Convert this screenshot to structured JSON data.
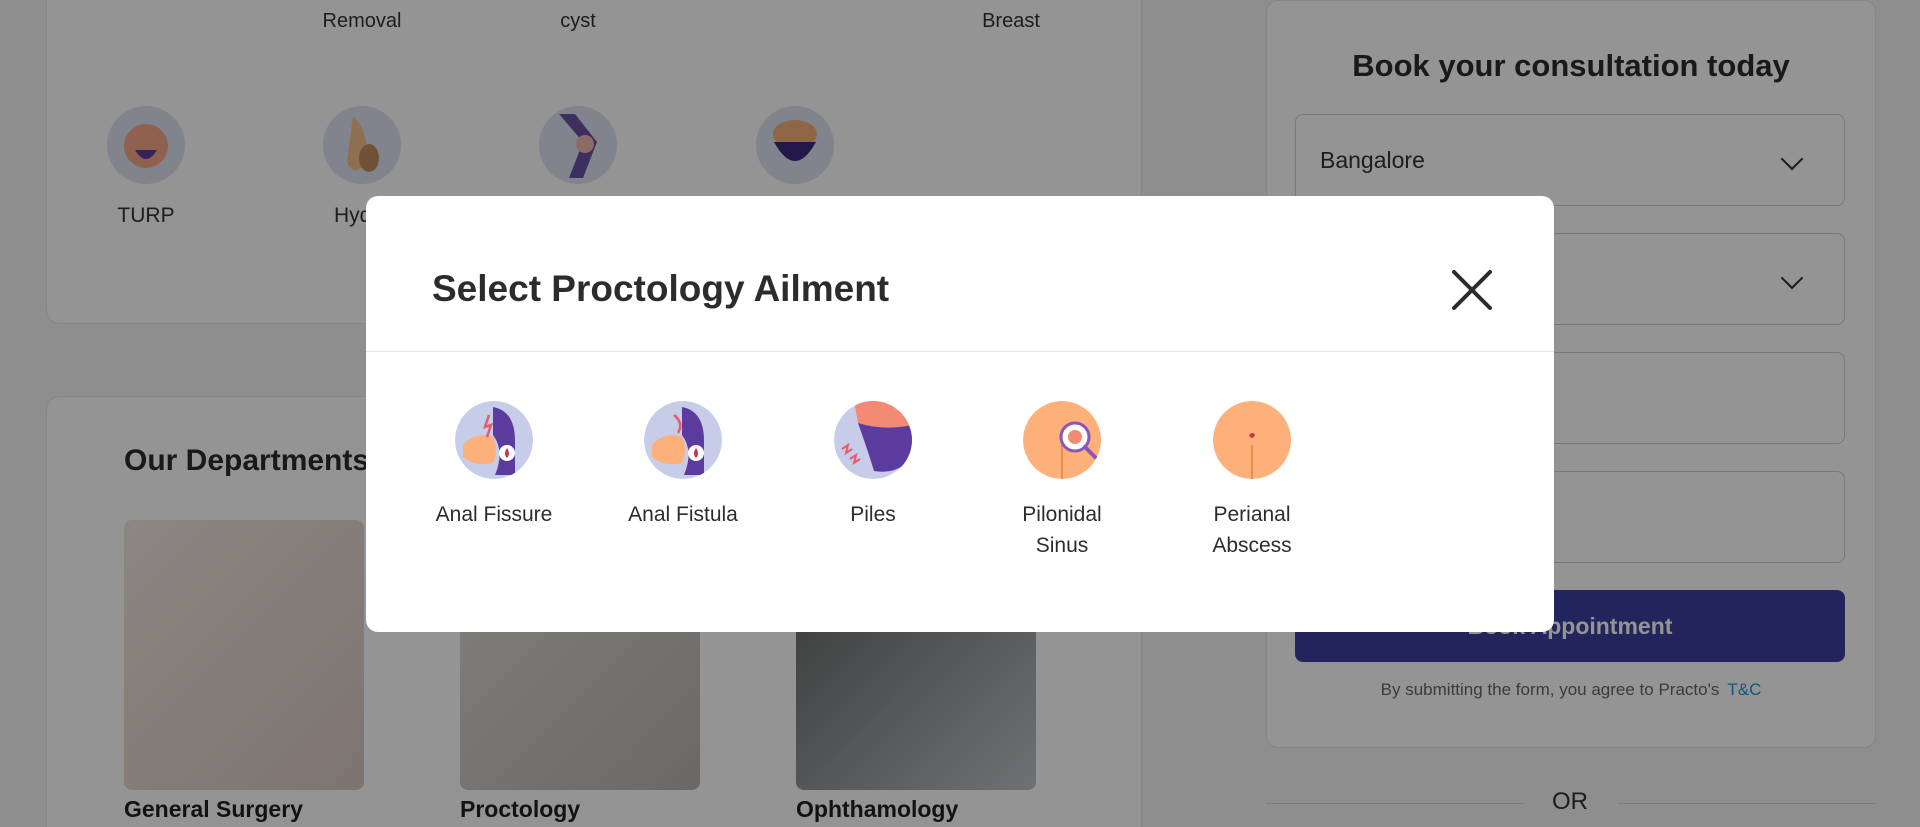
{
  "background": {
    "top_labels": [
      "Removal",
      "cyst",
      "Breast"
    ],
    "surgeries": [
      {
        "label": "TURP",
        "icon": "prostate-icon",
        "color": "#f4a988"
      },
      {
        "label": "Hydro",
        "icon": "hydrocele-icon",
        "color": "#f4c08a"
      },
      {
        "label": "",
        "icon": "knee-icon",
        "color": "#6a54a8"
      },
      {
        "label": "",
        "icon": "hair-transplant-icon",
        "color": "#f4b07a"
      }
    ],
    "departments_title": "Our Departments",
    "departments": [
      {
        "name": "General Surgery",
        "color": "#e8e0d8"
      },
      {
        "name": "Proctology",
        "color": "#d8d4cf"
      },
      {
        "name": "Ophthamology",
        "color": "#7a7a7a"
      }
    ],
    "form": {
      "title": "Book your consultation today",
      "city": "Bangalore",
      "book_label": "Book Appointment",
      "terms_text": "By submitting the form, you agree to Practo's",
      "terms_link": "T&C",
      "or_label": "OR"
    }
  },
  "modal": {
    "title": "Select Proctology Ailment",
    "close_icon": "close-icon",
    "ailments": [
      {
        "line1": "Anal Fissure",
        "line2": "",
        "icon": "anal-fissure-icon"
      },
      {
        "line1": "Anal Fistula",
        "line2": "",
        "icon": "anal-fistula-icon"
      },
      {
        "line1": "Piles",
        "line2": "",
        "icon": "piles-icon"
      },
      {
        "line1": "Pilonidal",
        "line2": "Sinus",
        "icon": "pilonidal-sinus-icon"
      },
      {
        "line1": "Perianal",
        "line2": "Abscess",
        "icon": "perianal-abscess-icon"
      }
    ]
  },
  "colors": {
    "accent": "#3c3f9e",
    "link": "#1a96d6",
    "icon_bg": "#c7cce8",
    "skin": "#fdb07a",
    "purple": "#5b3c9e"
  }
}
